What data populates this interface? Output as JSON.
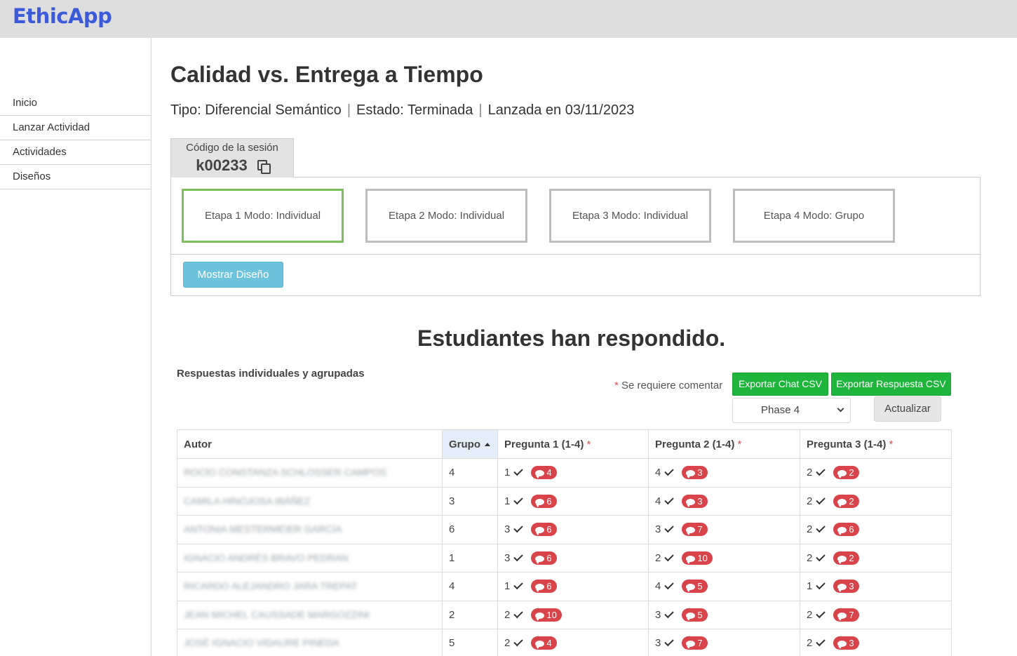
{
  "app": {
    "brand": "EthicApp"
  },
  "sidebar": {
    "items": [
      {
        "label": "Inicio"
      },
      {
        "label": "Lanzar Actividad"
      },
      {
        "label": "Actividades"
      },
      {
        "label": "Diseños"
      }
    ]
  },
  "activity": {
    "title": "Calidad vs. Entrega a Tiempo",
    "type": "Tipo: Diferencial Semántico",
    "status": "Estado: Terminada",
    "launched": "Lanzada en 03/11/2023",
    "separator": "|"
  },
  "session": {
    "label": "Código de la sesión",
    "code": "k00233"
  },
  "stages": [
    {
      "label": "Etapa 1 Modo: Individual",
      "active": true
    },
    {
      "label": "Etapa 2 Modo: Individual",
      "active": false
    },
    {
      "label": "Etapa 3 Modo: Individual",
      "active": false
    },
    {
      "label": "Etapa 4 Modo: Grupo",
      "active": false
    }
  ],
  "buttons": {
    "show_design": "Mostrar Diseño",
    "export_chat": "Exportar Chat CSV",
    "export_response": "Exportar Respuesta CSV",
    "update": "Actualizar"
  },
  "responses": {
    "heading": "Estudiantes han respondido.",
    "subheading": "Respuestas individuales y agrupadas",
    "required_star": "*",
    "required_note": "Se requiere comentar",
    "phase_selected": "Phase 4"
  },
  "table": {
    "headers": {
      "author": "Autor",
      "group": "Grupo",
      "q1": "Pregunta 1 (1-4)",
      "q2": "Pregunta 2 (1-4)",
      "q3": "Pregunta 3 (1-4)"
    },
    "rows": [
      {
        "author": "ROCÍO CONSTANZA SCHLOSSER CAMPOS",
        "group": "4",
        "q1": "1",
        "q1c": "4",
        "q2": "4",
        "q2c": "3",
        "q3": "2",
        "q3c": "2"
      },
      {
        "author": "CAMILA HINOJOSA IBÁÑEZ",
        "group": "3",
        "q1": "1",
        "q1c": "6",
        "q2": "4",
        "q2c": "3",
        "q3": "2",
        "q3c": "2"
      },
      {
        "author": "ANTONIA MESTERMEIER GARCÍA",
        "group": "6",
        "q1": "3",
        "q1c": "6",
        "q2": "3",
        "q2c": "7",
        "q3": "2",
        "q3c": "6"
      },
      {
        "author": "IGNACIO ANDRÉS BRAVO PEDRAN",
        "group": "1",
        "q1": "3",
        "q1c": "6",
        "q2": "2",
        "q2c": "10",
        "q3": "2",
        "q3c": "2"
      },
      {
        "author": "RICARDO ALEJANDRO JARA TREPAT",
        "group": "4",
        "q1": "1",
        "q1c": "6",
        "q2": "4",
        "q2c": "5",
        "q3": "1",
        "q3c": "3"
      },
      {
        "author": "JEAN MICHEL CAUSSADE MARGOZZINI",
        "group": "2",
        "q1": "2",
        "q1c": "10",
        "q2": "3",
        "q2c": "5",
        "q3": "2",
        "q3c": "7"
      },
      {
        "author": "JOSÉ IGNACIO VIDAURE PINEDA",
        "group": "5",
        "q1": "2",
        "q1c": "4",
        "q2": "3",
        "q2c": "7",
        "q3": "2",
        "q3c": "3"
      }
    ]
  },
  "colors": {
    "brand": "#3b5bdb",
    "active_stage": "#7cbf5a",
    "export_green": "#1fb53d",
    "info_button": "#6ec3dc",
    "badge_red": "#d9434a",
    "required_red": "#d9534f"
  },
  "icons": {
    "copy": "copy-icon",
    "check": "check-icon",
    "comment": "comment-icon",
    "sort": "sort-ascending-icon",
    "dropdown": "chevron-down-icon"
  }
}
